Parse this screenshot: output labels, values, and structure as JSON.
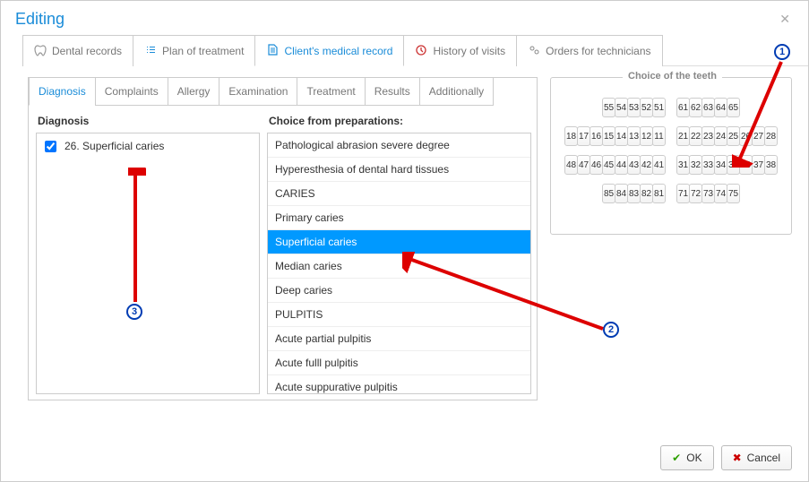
{
  "window": {
    "title": "Editing"
  },
  "top_tabs": [
    {
      "label": "Dental records",
      "icon": "tooth"
    },
    {
      "label": "Plan of treatment",
      "icon": "list"
    },
    {
      "label": "Client's medical record",
      "icon": "doc",
      "active": true
    },
    {
      "label": "History of visits",
      "icon": "clock"
    },
    {
      "label": "Orders for technicians",
      "icon": "gears"
    }
  ],
  "sub_tabs": [
    "Diagnosis",
    "Complaints",
    "Allergy",
    "Examination",
    "Treatment",
    "Results",
    "Additionally"
  ],
  "sub_tab_active": "Diagnosis",
  "diag": {
    "title": "Diagnosis",
    "items": [
      {
        "checked": true,
        "label": "26. Superficial caries"
      }
    ]
  },
  "prep": {
    "title": "Choice from preparations:",
    "items": [
      {
        "label": "Pathological abrasion severe degree"
      },
      {
        "label": "Hyperesthesia of dental hard tissues"
      },
      {
        "label": "CARIES"
      },
      {
        "label": "Primary caries"
      },
      {
        "label": "Superficial caries",
        "selected": true
      },
      {
        "label": "Median caries"
      },
      {
        "label": "Deep caries"
      },
      {
        "label": "PULPITIS"
      },
      {
        "label": "Acute partial pulpitis"
      },
      {
        "label": "Acute fulll pulpitis"
      },
      {
        "label": "Acute suppurative pulpitis"
      }
    ]
  },
  "teethbox": {
    "title": "Choice of the teeth"
  },
  "teeth_layout": [
    [
      [
        "55",
        "54",
        "53",
        "52",
        "51"
      ],
      [
        "61",
        "62",
        "63",
        "64",
        "65"
      ]
    ],
    [
      [
        "18",
        "17",
        "16",
        "15",
        "14",
        "13",
        "12",
        "11"
      ],
      [
        "21",
        "22",
        "23",
        "24",
        "25",
        "26",
        "27",
        "28"
      ]
    ],
    [
      [
        "48",
        "47",
        "46",
        "45",
        "44",
        "43",
        "42",
        "41"
      ],
      [
        "31",
        "32",
        "33",
        "34",
        "35",
        "36",
        "37",
        "38"
      ]
    ],
    [
      [
        "85",
        "84",
        "83",
        "82",
        "81"
      ],
      [
        "71",
        "72",
        "73",
        "74",
        "75"
      ]
    ]
  ],
  "buttons": {
    "ok": "OK",
    "cancel": "Cancel"
  },
  "annotations": {
    "m1": "1",
    "m2": "2",
    "m3": "3"
  }
}
